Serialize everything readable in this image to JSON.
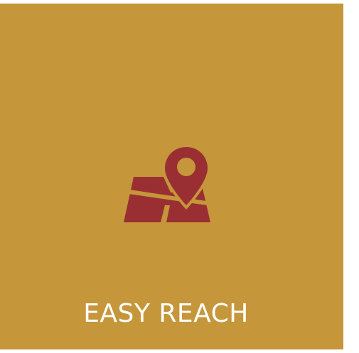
{
  "feature": {
    "caption": "EASY REACH",
    "icon": "map-location-pin-icon",
    "colors": {
      "background": "#c5963a",
      "icon": "#9a2f33",
      "text": "#ffffff"
    }
  }
}
